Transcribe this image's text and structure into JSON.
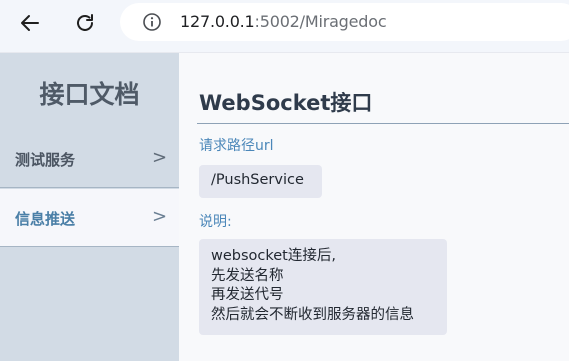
{
  "browser": {
    "back_icon": "arrow-left-icon",
    "reload_icon": "reload-icon",
    "info_icon": "info-circle-icon",
    "url_host": "127.0.0.1",
    "url_rest": ":5002/Miragedoc"
  },
  "sidebar": {
    "title": "接口文档",
    "items": [
      {
        "label": "测试服务",
        "chevron": ">",
        "active": false
      },
      {
        "label": "信息推送",
        "chevron": ">",
        "active": true
      }
    ]
  },
  "main": {
    "title": "WebSocket接口",
    "path_label": "请求路径url",
    "path_value": "/PushService",
    "desc_label": "说明:",
    "desc_lines": [
      "websocket连接后,",
      "先发送名称",
      "再发送代号",
      "然后就会不断收到服务器的信息"
    ]
  },
  "colors": {
    "sidebar_bg": "#d2dbe5",
    "accent": "#4b87b9",
    "code_bg": "#e5e7f0",
    "title_text": "#2f3b4b"
  }
}
